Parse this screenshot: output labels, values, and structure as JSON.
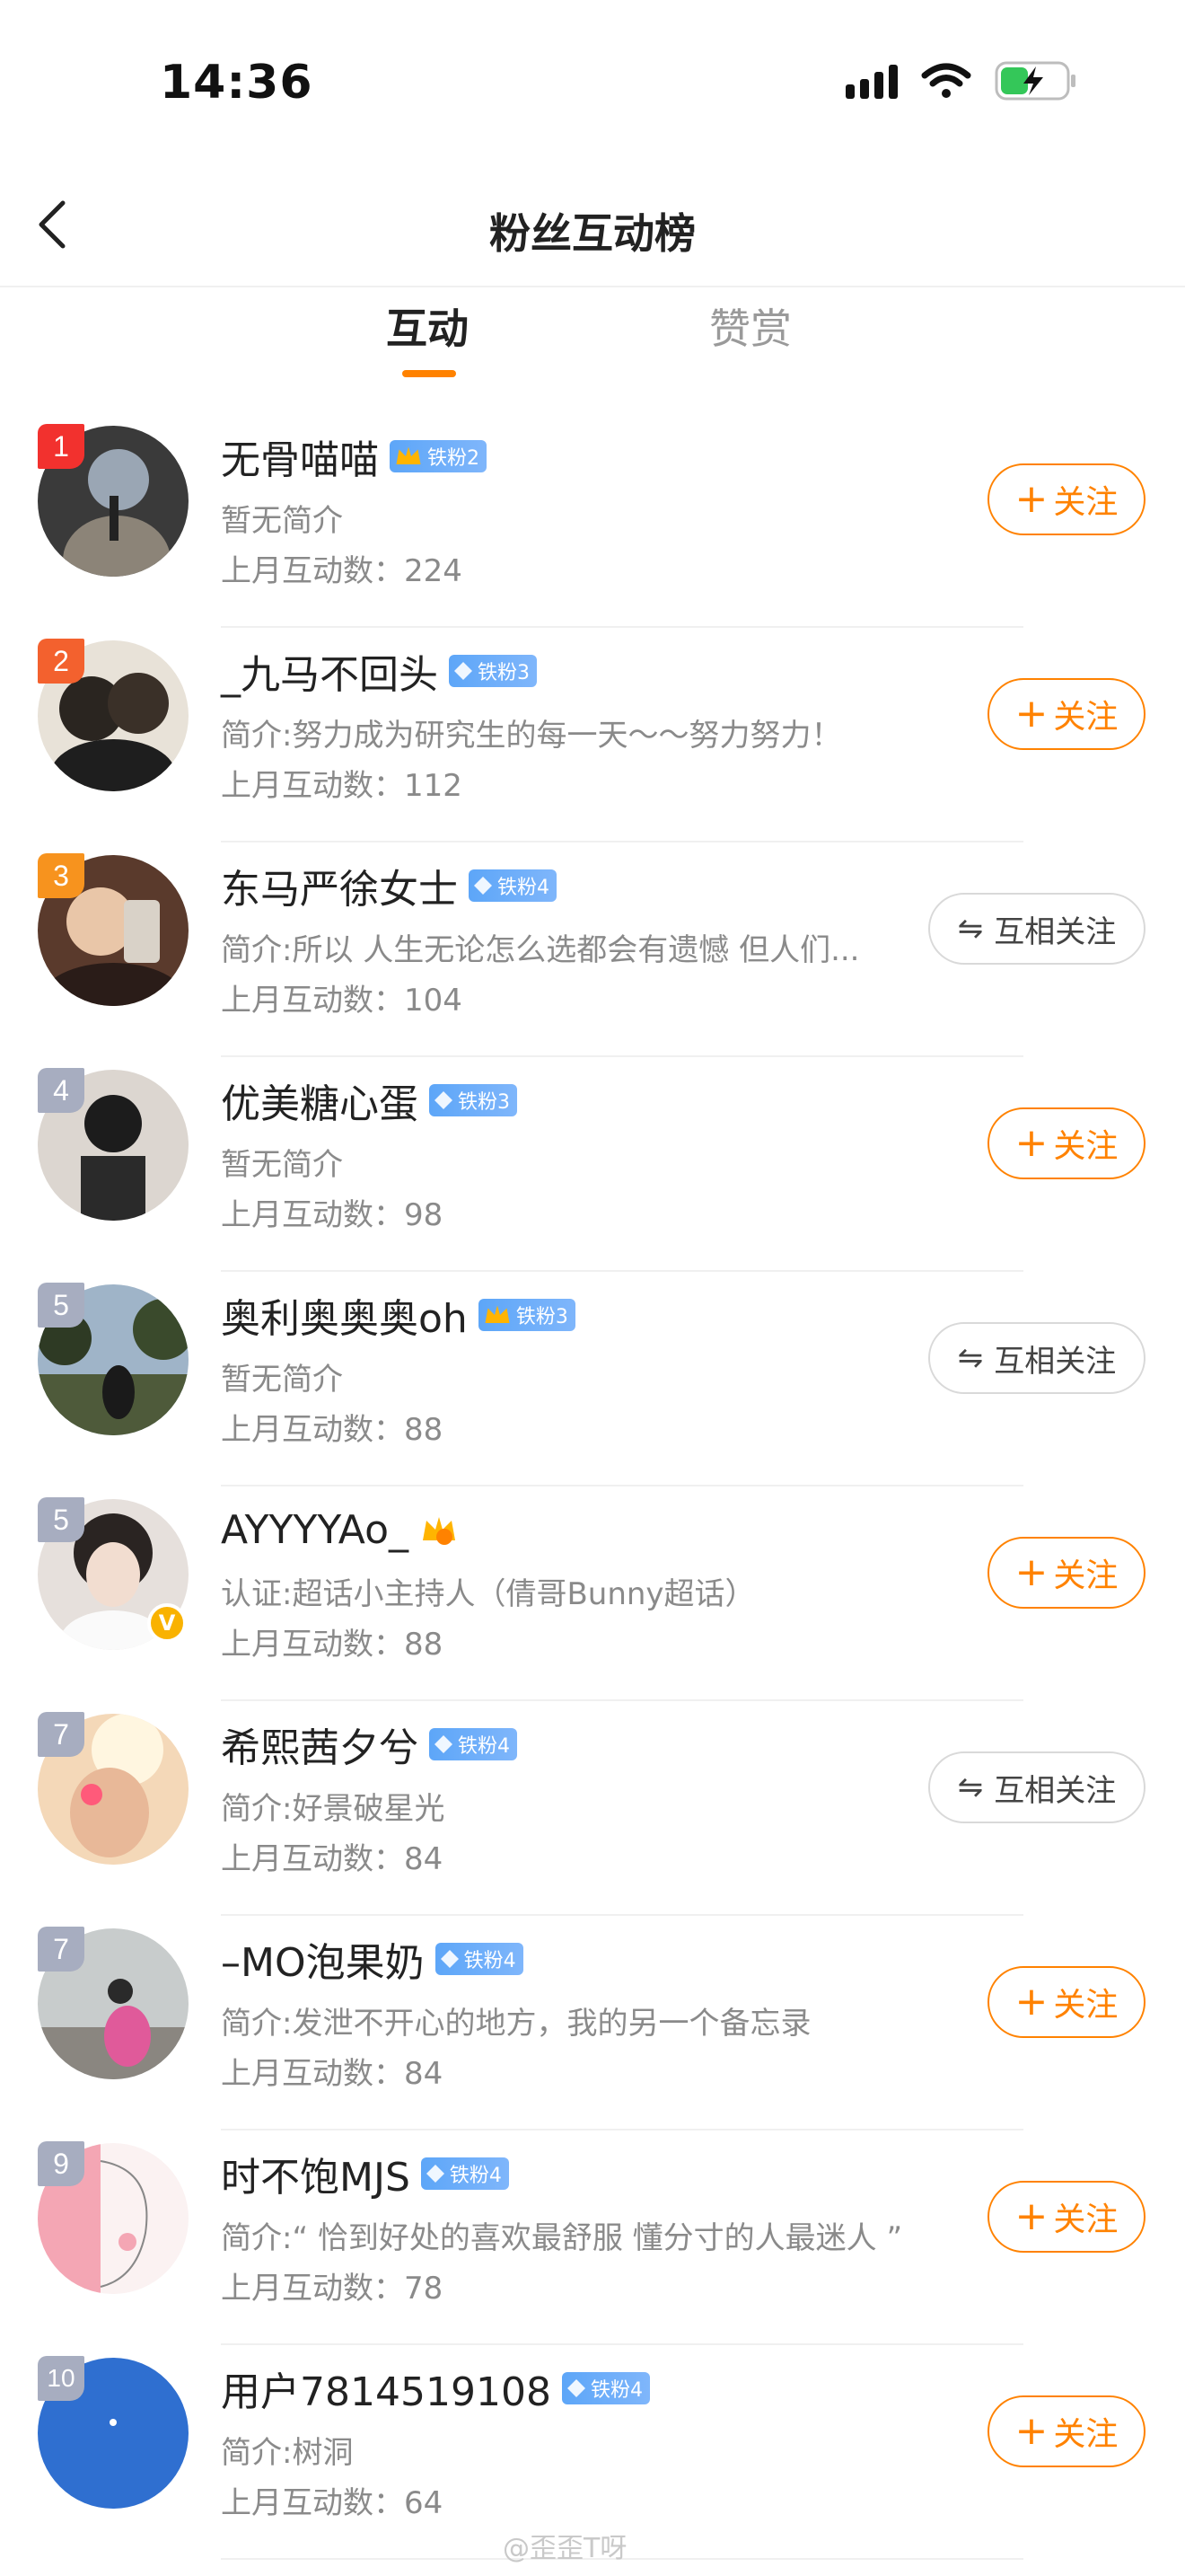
{
  "status_bar": {
    "time": "14:36"
  },
  "nav": {
    "title": "粉丝互动榜"
  },
  "tabs": [
    {
      "label": "互动",
      "active": true
    },
    {
      "label": "赞赏",
      "active": false
    }
  ],
  "colors": {
    "accent": "#ff8200",
    "rank1": "#f2312e",
    "rank2": "#f3612e",
    "rank3": "#f7931e",
    "rank_other": "#a7adc0",
    "fan_badge": "#5da6f8"
  },
  "users": [
    {
      "rank": "1",
      "name": "无骨喵喵",
      "badge_icon": "crown-icon",
      "badge_text": "铁粉2",
      "intro": "暂无简介",
      "count": "上月互动数：224",
      "action": "关注",
      "action_type": "follow"
    },
    {
      "rank": "2",
      "name": "_九马不回头",
      "badge_icon": "diamond-icon",
      "badge_text": "铁粉3",
      "intro": "简介:努力成为研究生的每一天～～努力努力！",
      "count": "上月互动数：112",
      "action": "关注",
      "action_type": "follow"
    },
    {
      "rank": "3",
      "name": "东马严徐女士",
      "badge_icon": "diamond-icon",
      "badge_text": "铁粉4",
      "intro": "简介:所以 人生无论怎么选都会有遗憾 但人们...",
      "count": "上月互动数：104",
      "action": "互相关注",
      "action_type": "mutual"
    },
    {
      "rank": "4",
      "name": "优美糖心蛋",
      "badge_icon": "diamond-icon",
      "badge_text": "铁粉3",
      "intro": "暂无简介",
      "count": "上月互动数：98",
      "action": "关注",
      "action_type": "follow"
    },
    {
      "rank": "5",
      "name": "奥利奥奥奥oh",
      "badge_icon": "crown-icon",
      "badge_text": "铁粉3",
      "intro": "暂无简介",
      "count": "上月互动数：88",
      "action": "互相关注",
      "action_type": "mutual"
    },
    {
      "rank": "5",
      "name": "AYYYYAo_",
      "badge_icon": "crown-icon",
      "badge_text": "",
      "intro": "认证:超话小主持人（倩哥Bunny超话）",
      "count": "上月互动数：88",
      "action": "关注",
      "action_type": "follow",
      "verified": true
    },
    {
      "rank": "7",
      "name": "希熙茜夕兮",
      "badge_icon": "diamond-icon",
      "badge_text": "铁粉4",
      "intro": "简介:好景破星光",
      "count": "上月互动数：84",
      "action": "互相关注",
      "action_type": "mutual"
    },
    {
      "rank": "7",
      "name": "–MO泡果奶",
      "badge_icon": "diamond-icon",
      "badge_text": "铁粉4",
      "intro": "简介:发泄不开心的地方，我的另一个备忘录",
      "count": "上月互动数：84",
      "action": "关注",
      "action_type": "follow"
    },
    {
      "rank": "9",
      "name": "时不饱MJS",
      "badge_icon": "diamond-icon",
      "badge_text": "铁粉4",
      "intro": "简介:“ 恰到好处的喜欢最舒服 懂分寸的人最迷人 ”",
      "count": "上月互动数：78",
      "action": "关注",
      "action_type": "follow"
    },
    {
      "rank": "10",
      "name": "用户7814519108",
      "badge_icon": "diamond-icon",
      "badge_text": "铁粉4",
      "intro": "简介:树洞",
      "count": "上月互动数：64",
      "action": "关注",
      "action_type": "follow"
    }
  ],
  "watermark": "@歪歪T呀"
}
